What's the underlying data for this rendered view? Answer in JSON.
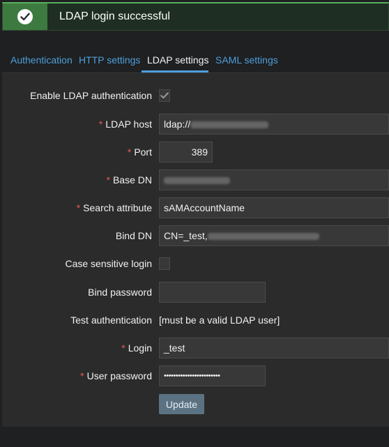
{
  "banner": {
    "message": "LDAP login successful",
    "icon": "check-circle-icon",
    "accent": "#59b05c"
  },
  "tabs": [
    {
      "label": "Authentication",
      "active": false
    },
    {
      "label": "HTTP settings",
      "active": false
    },
    {
      "label": "LDAP settings",
      "active": true
    },
    {
      "label": "SAML settings",
      "active": false
    }
  ],
  "form": {
    "enable_ldap": {
      "label": "Enable LDAP authentication",
      "checked": true
    },
    "ldap_host": {
      "label": "LDAP host",
      "required": true,
      "value": "ldap://"
    },
    "port": {
      "label": "Port",
      "required": true,
      "value": "389"
    },
    "base_dn": {
      "label": "Base DN",
      "required": true,
      "value": ""
    },
    "search_attribute": {
      "label": "Search attribute",
      "required": true,
      "value": "sAMAccountName"
    },
    "bind_dn": {
      "label": "Bind DN",
      "required": false,
      "value": "CN=_test,"
    },
    "case_sensitive": {
      "label": "Case sensitive login",
      "checked": false
    },
    "bind_password": {
      "label": "Bind password",
      "value": ""
    },
    "test_auth": {
      "label": "Test authentication",
      "value": "[must be a valid LDAP user]"
    },
    "login": {
      "label": "Login",
      "required": true,
      "value": "_test"
    },
    "user_password": {
      "label": "User password",
      "required": true,
      "value": "••••••••••••••••••••••••"
    },
    "update_button": "Update"
  },
  "colors": {
    "link": "#4f9fdc",
    "required": "#e45959",
    "panel": "#2b2b2b"
  }
}
